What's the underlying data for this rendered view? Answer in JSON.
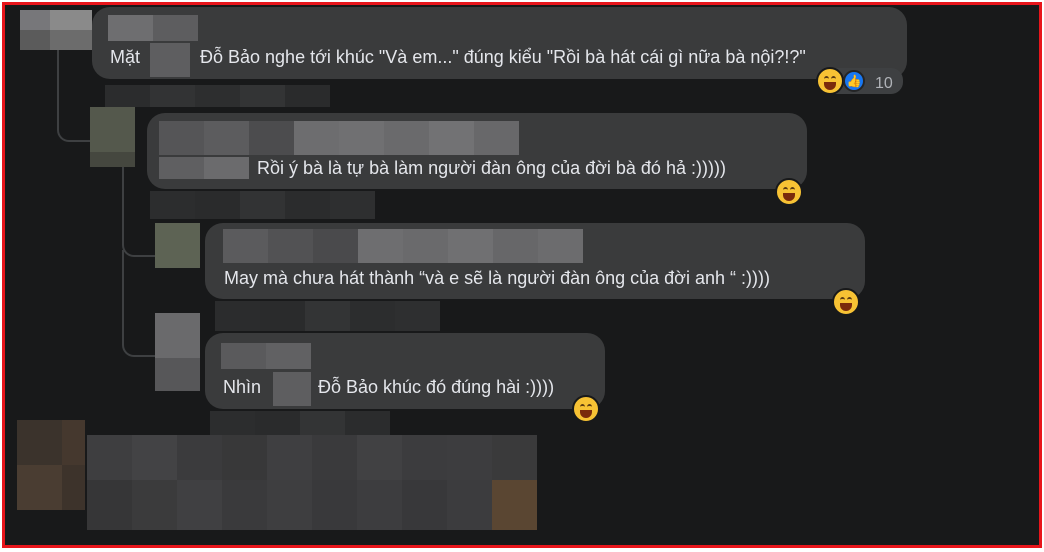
{
  "comments": [
    {
      "text_after_name": "Đỗ Bảo nghe tới khúc \"Và em...\" đúng kiểu \"Rồi bà hát cái gì nữa bà nội?!?\"",
      "prefix": "Mặt",
      "reaction_count": "10",
      "reactions": [
        "grin-emoji",
        "like-icon"
      ]
    },
    {
      "text": "Rồi ý bà là tự bà làm người đàn ông của đời bà đó hả :)))))",
      "reactions": [
        "grin-emoji"
      ]
    },
    {
      "text": "May mà chưa hát thành “và e sẽ là người đàn ông của đời anh “ :))))",
      "reactions": [
        "grin-emoji"
      ]
    },
    {
      "prefix": "Nhìn",
      "text_after_name": "Đỗ Bảo khúc đó đúng hài :))))",
      "reactions": [
        "grin-emoji"
      ]
    }
  ],
  "colors": {
    "background": "#18191a",
    "bubble": "#3a3b3c",
    "text": "#e4e6eb",
    "frame_border": "#e8151b",
    "like_blue": "#1877f2"
  }
}
